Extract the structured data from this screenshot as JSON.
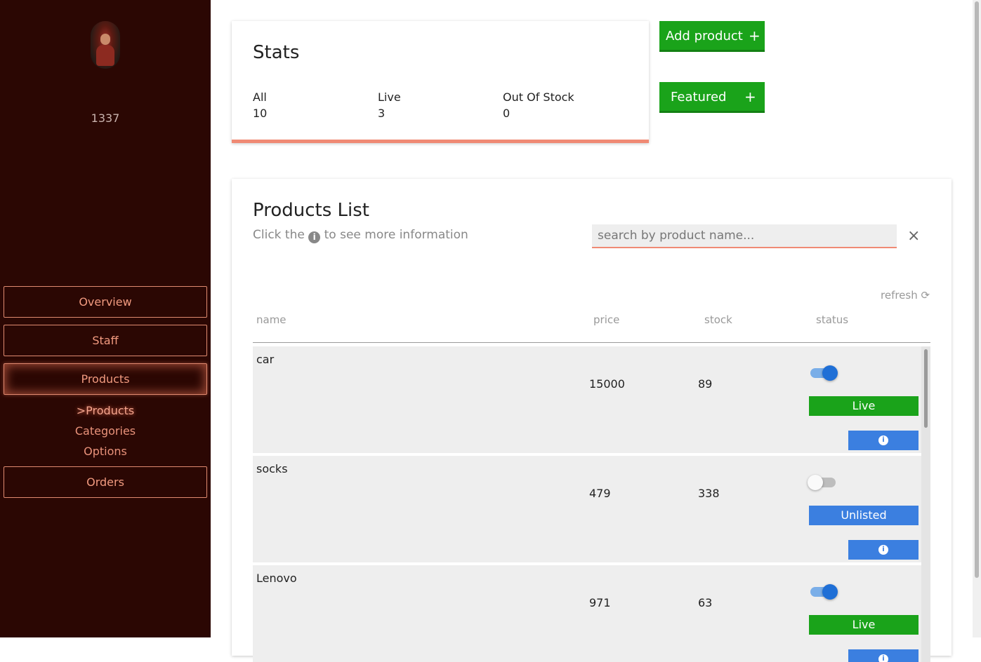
{
  "sidebar": {
    "user_id": "1337",
    "nav": {
      "overview": "Overview",
      "staff": "Staff",
      "products": "Products",
      "orders": "Orders"
    },
    "sub_links": {
      "products": ">Products",
      "categories": "Categories",
      "options": "Options"
    }
  },
  "stats": {
    "title": "Stats",
    "all_label": "All",
    "all_value": "10",
    "live_label": "Live",
    "live_value": "3",
    "out_label": "Out Of Stock",
    "out_value": "0"
  },
  "actions": {
    "add_product": "Add product",
    "featured": "Featured",
    "plus": "+"
  },
  "products": {
    "title": "Products List",
    "subtitle_before": "Click the",
    "subtitle_after": "to see more information",
    "search_placeholder": "search by product name...",
    "clear": "×",
    "refresh": "refresh ⟳",
    "columns": {
      "name": "name",
      "price": "price",
      "stock": "stock",
      "status": "status"
    },
    "rows": [
      {
        "name": "car",
        "price": "15000",
        "stock": "89",
        "status": "Live",
        "listed": true
      },
      {
        "name": "socks",
        "price": "479",
        "stock": "338",
        "status": "Unlisted",
        "listed": false
      },
      {
        "name": "Lenovo",
        "price": "971",
        "stock": "63",
        "status": "Live",
        "listed": true
      }
    ]
  },
  "colors": {
    "sidebar_bg": "#2b0703",
    "accent": "#f08a74",
    "green": "#1aa31a",
    "blue": "#3b7fe0"
  }
}
